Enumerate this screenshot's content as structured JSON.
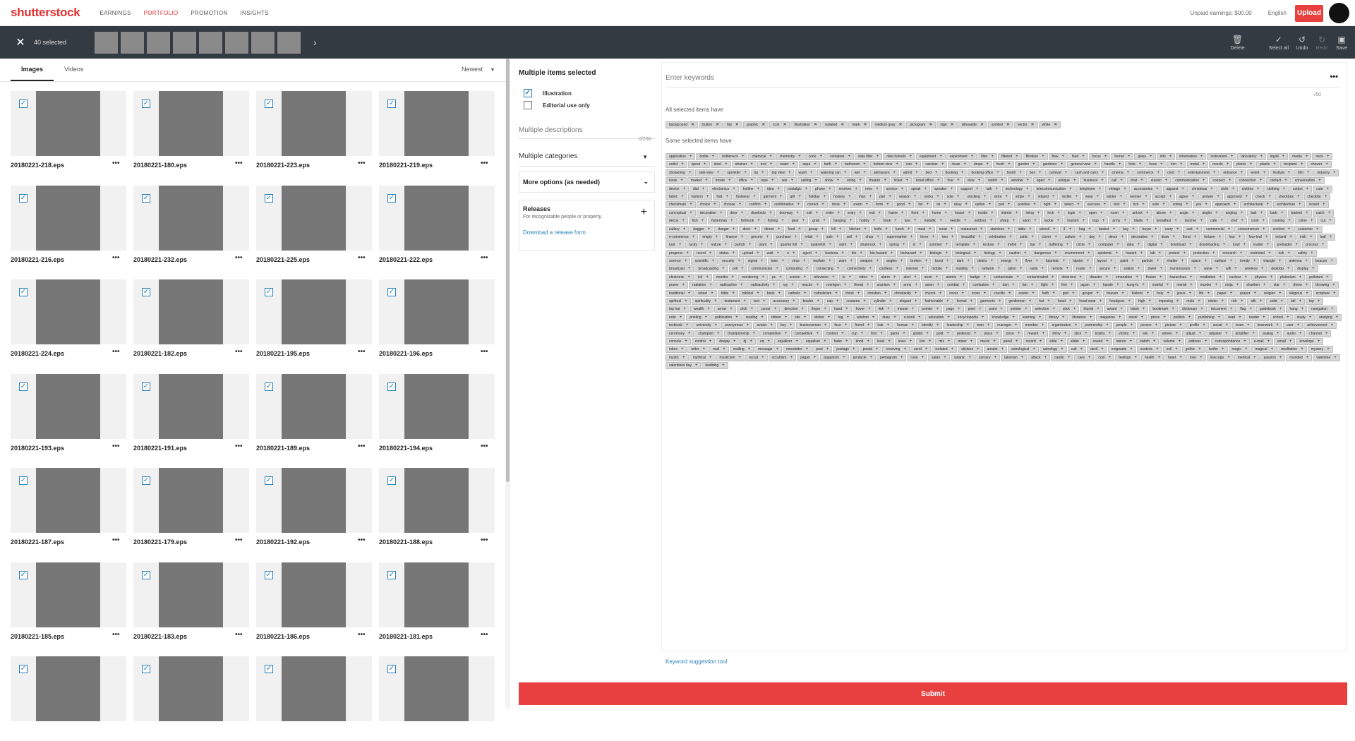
{
  "topnav": {
    "logo": "shutterstock",
    "links": [
      "EARNINGS",
      "PORTFOLIO",
      "PROMOTION",
      "INSIGHTS"
    ],
    "active_link": "PORTFOLIO",
    "earnings": "Unpaid earnings: $00.00",
    "language": "English",
    "upload_label": "Upload"
  },
  "selection_bar": {
    "count_label": "40 selected",
    "thumb_count": 8,
    "tools": [
      {
        "icon": "trash-icon",
        "label": "Delete"
      },
      {
        "icon": "check-icon",
        "label": "Select all"
      },
      {
        "icon": "undo-icon",
        "label": "Undo"
      },
      {
        "icon": "redo-icon",
        "label": "Redo"
      },
      {
        "icon": "save-icon",
        "label": "Save"
      }
    ]
  },
  "left": {
    "tabs": [
      "Images",
      "Videos"
    ],
    "active_tab": "Images",
    "sort_label": "Newest",
    "files": [
      "20180221-218.eps",
      "20180221-180.eps",
      "20180221-223.eps",
      "20180221-219.eps",
      "20180221-216.eps",
      "20180221-232.eps",
      "20180221-225.eps",
      "20180221-222.eps",
      "20180221-224.eps",
      "20180221-182.eps",
      "20180221-195.eps",
      "20180221-196.eps",
      "20180221-193.eps",
      "20180221-191.eps",
      "20180221-189.eps",
      "20180221-194.eps",
      "20180221-187.eps",
      "20180221-179.eps",
      "20180221-192.eps",
      "20180221-188.eps",
      "20180221-185.eps",
      "20180221-183.eps",
      "20180221-186.eps",
      "20180221-181.eps",
      "",
      "",
      "",
      ""
    ],
    "more_label": "•••"
  },
  "middle": {
    "title": "Multiple items selected",
    "checkbox_illustration": "Illustration",
    "checkbox_editorial": "Editorial use only",
    "description_placeholder": "Multiple descriptions",
    "description_count": "0/200",
    "categories_label": "Multiple categories",
    "more_options_label": "More options (as needed)",
    "releases_title": "Releases",
    "releases_subtitle": "For recognizable people or property.",
    "releases_link": "Download a release form",
    "submit_label": "Submit"
  },
  "keywords": {
    "input_placeholder": "Enter keywords",
    "count": "-/50",
    "all_label": "All selected items have",
    "some_label": "Some selected items have",
    "suggestion_link": "Keyword suggestion tool",
    "all": [
      "background",
      "button",
      "flat",
      "graphic",
      "icon",
      "illustration",
      "isolated",
      "mark",
      "medium gray",
      "pictogram",
      "sign",
      "silhouette",
      "symbol",
      "vector",
      "white"
    ],
    "some": [
      "application",
      "bottle",
      "bottleneck",
      "chemical",
      "chemistry",
      "cone",
      "container",
      "data filter",
      "data funnels",
      "equipment",
      "experiment",
      "filter",
      "filtered",
      "filtration",
      "flow",
      "fluid",
      "focus",
      "funnel",
      "glass",
      "info",
      "information",
      "instrument",
      "laboratory",
      "liquid",
      "media",
      "neck",
      "outlet",
      "spout",
      "steel",
      "strainer",
      "tool",
      "water",
      "aqua",
      "bath",
      "bathroom",
      "bottom view",
      "can",
      "canister",
      "clean",
      "drops",
      "fresh",
      "garden",
      "gardener",
      "general view",
      "handle",
      "hole",
      "hose",
      "iron",
      "metal",
      "nozzle",
      "plants",
      "plastic",
      "recipient",
      "shower",
      "showering",
      "side view",
      "sprinkler",
      "tip",
      "top view",
      "wash",
      "watering can",
      "wet",
      "admission",
      "admit",
      "bed",
      "booking",
      "booking office",
      "booth",
      "box",
      "carnival",
      "cash and carry",
      "cinema",
      "commerce",
      "cord",
      "entertainment",
      "entrance",
      "event",
      "festival",
      "film",
      "industry",
      "kiosk",
      "market",
      "movie",
      "office",
      "rope",
      "see",
      "selling",
      "show",
      "string",
      "theater",
      "ticket",
      "ticket office",
      "tour",
      "view",
      "watch",
      "window",
      "aged",
      "antique",
      "business",
      "call",
      "chat",
      "classic",
      "communication",
      "connect",
      "connection",
      "contact",
      "conversation",
      "device",
      "dial",
      "electronics",
      "hotline",
      "idea",
      "nostalgic",
      "phone",
      "receiver",
      "retro",
      "service",
      "speak",
      "speaker",
      "support",
      "talk",
      "technology",
      "telecommunication",
      "telephone",
      "vintage",
      "accessories",
      "apparel",
      "christmas",
      "cloth",
      "clothes",
      "clothing",
      "cotton",
      "cute",
      "fabric",
      "fashion",
      "fold",
      "footwear",
      "garment",
      "gift",
      "holiday",
      "hosiery",
      "man",
      "pair",
      "season",
      "socks",
      "sole",
      "stocking",
      "store",
      "stripe",
      "striped",
      "textile",
      "wear",
      "winter",
      "women",
      "accept",
      "agree",
      "answer",
      "approved",
      "check",
      "checkbox",
      "checklist",
      "checkmark",
      "choice",
      "choose",
      "confirm",
      "confirmation",
      "correct",
      "done",
      "exam",
      "form",
      "good",
      "list",
      "ok",
      "okay",
      "option",
      "poll",
      "positive",
      "right",
      "select",
      "success",
      "test",
      "tick",
      "vote",
      "voting",
      "yes",
      "approach",
      "architectural",
      "architecture",
      "closed",
      "conceptual",
      "decoration",
      "door",
      "doorknob",
      "doorway",
      "exit",
      "enter",
      "entry",
      "exit",
      "frame",
      "front",
      "home",
      "house",
      "inside",
      "interior",
      "living",
      "lock",
      "login",
      "open",
      "room",
      "unlock",
      "above",
      "angle",
      "angler",
      "angling",
      "bait",
      "barb",
      "barbed",
      "catch",
      "decoy",
      "fish",
      "fisherman",
      "fishhook",
      "fishing",
      "gear",
      "grab",
      "hanging",
      "hobby",
      "hook",
      "lure",
      "metallic",
      "needle",
      "outdoor",
      "sharp",
      "sport",
      "tackle",
      "tourism",
      "trap",
      "army",
      "blade",
      "breakfast",
      "butcher",
      "cafe",
      "chef",
      "cook",
      "cooking",
      "crime",
      "cut",
      "cutlery",
      "dagger",
      "danger",
      "diner",
      "dinner",
      "food",
      "group",
      "kill",
      "kitchen",
      "knife",
      "lunch",
      "meal",
      "meat",
      "restaurant",
      "stainless",
      "table",
      "utensil",
      "3",
      "bag",
      "basket",
      "buy",
      "buyer",
      "carry",
      "cart",
      "commercial",
      "consumerism",
      "content",
      "customer",
      "e-commerce",
      "empty",
      "finance",
      "grocery",
      "purchase",
      "retail",
      "sale",
      "sell",
      "shop",
      "supermarket",
      "three",
      "two",
      "beautiful",
      "celebration",
      "cattic",
      "clover",
      "culture",
      "day",
      "decor",
      "decorative",
      "draw",
      "floral",
      "fortune",
      "four",
      "four-leaf",
      "ireland",
      "irish",
      "leaf",
      "luck",
      "lucky",
      "nature",
      "patrick",
      "plant",
      "quarter foil",
      "quatrefoil",
      "saint",
      "shamrock",
      "spring",
      "st",
      "summer",
      "template",
      "texture",
      "trefoil",
      "bar",
      "buffering",
      "circle",
      "computer",
      "data",
      "digital",
      "download",
      "downloading",
      "load",
      "loader",
      "preloader",
      "process",
      "progress",
      "round",
      "status",
      "upload",
      "wait",
      "a",
      "agent",
      "bacteria",
      "bio",
      "bio-hazard",
      "biohazard",
      "biologic",
      "biological",
      "biology",
      "caution",
      "dangerous",
      "environment",
      "epidemic",
      "hazard",
      "lab",
      "protect",
      "protection",
      "research",
      "restricted",
      "risk",
      "safety",
      "science",
      "scientific",
      "security",
      "signal",
      "toxic",
      "virus",
      "warfare",
      "warn",
      "weapon",
      "angles",
      "broken",
      "burst",
      "dark",
      "debris",
      "energy",
      "flyer",
      "futuristic",
      "hipster",
      "layout",
      "paint",
      "particle",
      "shatter",
      "space",
      "surface",
      "trendy",
      "triangle",
      "antenna",
      "beacon",
      "broadcast",
      "broadcasting",
      "cell",
      "communicate",
      "computing",
      "connecting",
      "connectivity",
      "cordless",
      "internet",
      "mobile",
      "mobility",
      "network",
      "pylon",
      "radio",
      "remote",
      "router",
      "secure",
      "station",
      "tower",
      "transmission",
      "wave",
      "wifi",
      "wireless",
      "desktop",
      "display",
      "electronic",
      "lcd",
      "monitor",
      "monitoring",
      "pc",
      "screen",
      "television",
      "tv",
      "video",
      "alarm",
      "alert",
      "atom",
      "atomic",
      "badge",
      "contaminate",
      "contaminated",
      "deterrent",
      "disaster",
      "emanation",
      "fission",
      "hazardous",
      "irradiation",
      "nuclear",
      "physics",
      "plutonium",
      "pollutant",
      "power",
      "radiation",
      "radioactive",
      "radioactivity",
      "ray",
      "reactor",
      "roentgen",
      "threat",
      "uranium",
      "arms",
      "asian",
      "combat",
      "combative",
      "dart",
      "fan",
      "fight",
      "five",
      "japan",
      "karate",
      "kung-fu",
      "martial",
      "mortal",
      "murder",
      "ninja",
      "shuriken",
      "star",
      "throw",
      "throwing",
      "traditional",
      "wheel",
      "bible",
      "biblical",
      "book",
      "catholic",
      "catholicism",
      "christ",
      "christian",
      "christianity",
      "church",
      "cover",
      "cross",
      "crucifix",
      "easter",
      "faith",
      "god",
      "gospel",
      "heaven",
      "historic",
      "holy",
      "jesus",
      "life",
      "paper",
      "prayer",
      "religion",
      "religious",
      "scripture",
      "spiritual",
      "spirituality",
      "testament",
      "text",
      "accessory",
      "bowler",
      "cap",
      "costume",
      "cylinder",
      "elegant",
      "fashionable",
      "formal",
      "garments",
      "gentleman",
      "hat",
      "head",
      "head wear",
      "headgear",
      "high",
      "imposing",
      "male",
      "mister",
      "rich",
      "silk",
      "solid",
      "tall",
      "top",
      "top hat",
      "wealth",
      "arrow",
      "click",
      "cursor",
      "direction",
      "finger",
      "hand",
      "hover",
      "link",
      "mouse",
      "pointer",
      "page",
      "pixel",
      "point",
      "pointer",
      "selection",
      "stick",
      "thumb",
      "award",
      "blank",
      "bookmark",
      "dictionary",
      "document",
      "flag",
      "guidebook",
      "hang",
      "navigation",
      "note",
      "printing",
      "publication",
      "reading",
      "ribbon",
      "site",
      "sticker",
      "tag",
      "wisdom",
      "diary",
      "e-book",
      "education",
      "encyclopedia",
      "knowledge",
      "learning",
      "library",
      "literature",
      "magazine",
      "novel",
      "press",
      "publish",
      "publishing",
      "read",
      "reader",
      "school",
      "study",
      "studying",
      "textbook",
      "university",
      "anonymous",
      "avatar",
      "boy",
      "businessman",
      "face",
      "friend",
      "hair",
      "human",
      "identity",
      "leadership",
      "man",
      "manager",
      "member",
      "organization",
      "partnership",
      "people",
      "person",
      "picture",
      "profile",
      "social",
      "team",
      "teamwork",
      "user",
      "achievement",
      "ceremony",
      "champion",
      "championship",
      "competition",
      "competitive",
      "contest",
      "cup",
      "first",
      "game",
      "goblet",
      "gold",
      "pedestal",
      "place",
      "prize",
      "reward",
      "shiny",
      "stick",
      "trophy",
      "victory",
      "win",
      "winner",
      "adjust",
      "adjuster",
      "amplifier",
      "analog",
      "audio",
      "channel",
      "console",
      "control",
      "deejay",
      "dj",
      "eq",
      "equalizer",
      "equaliser",
      "fader",
      "knob",
      "level",
      "lever",
      "low",
      "mix",
      "mixer",
      "music",
      "panel",
      "record",
      "slide",
      "slider",
      "sound",
      "stereo",
      "switch",
      "volume",
      "address",
      "correspondence",
      "e-mail",
      "email",
      "envelope",
      "inbox",
      "letter",
      "mail",
      "mailing",
      "message",
      "newsletter",
      "post",
      "postage",
      "postal",
      "receiving",
      "send",
      "isolated",
      "stickers",
      "amulet",
      "astrological",
      "astrology",
      "cult",
      "devil",
      "enigmatic",
      "esoteric",
      "evil",
      "gothic",
      "lucifer",
      "magic",
      "magical",
      "meditation",
      "mystery",
      "mystic",
      "mythical",
      "mysticism",
      "occult",
      "occultism",
      "pagan",
      "paganism",
      "pentacle",
      "pentagram",
      "rune",
      "satan",
      "satanic",
      "sorcery",
      "talisman",
      "attack",
      "cardio",
      "care",
      "cool",
      "feelings",
      "health",
      "heart",
      "love",
      "love sign",
      "medical",
      "passion",
      "rounded",
      "valentine",
      "valentines day",
      "wedding"
    ]
  }
}
